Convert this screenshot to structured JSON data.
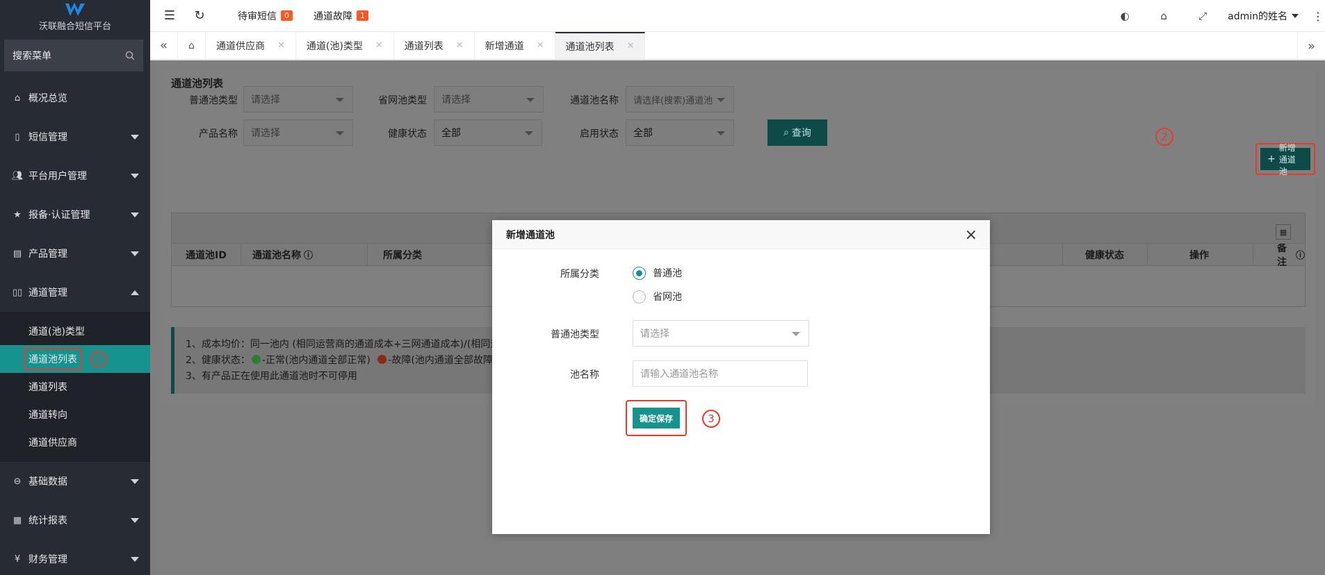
{
  "app": {
    "title": "沃联融合短信平台"
  },
  "sidebar": {
    "search_label": "搜索菜单",
    "items": [
      {
        "label": "概况总览",
        "icon": "home-icon"
      },
      {
        "label": "短信管理",
        "icon": "phone-icon"
      },
      {
        "label": "平台用户管理",
        "icon": "users-icon"
      },
      {
        "label": "报备·认证管理",
        "icon": "star-icon"
      },
      {
        "label": "产品管理",
        "icon": "product-icon"
      },
      {
        "label": "通道管理",
        "icon": "channel-icon"
      },
      {
        "label": "基础数据",
        "icon": "data-icon"
      },
      {
        "label": "统计报表",
        "icon": "report-icon"
      },
      {
        "label": "财务管理",
        "icon": "finance-icon"
      }
    ],
    "sub_items": [
      "通道(池)类型",
      "通道池列表",
      "通道列表",
      "通道转向",
      "通道供应商"
    ],
    "annotation_1": "1"
  },
  "topbar": {
    "pending_sms": "待审短信",
    "pending_sms_count": "0",
    "channel_fault": "通道故障",
    "channel_fault_count": "1",
    "user_name": "admin的姓名"
  },
  "tabs": [
    "通道供应商",
    "通道(池)类型",
    "通道列表",
    "新增通道",
    "通道池列表"
  ],
  "page": {
    "title": "通道池列表",
    "filters": {
      "normal_pool_type_label": "普通池类型",
      "normal_pool_type_value": "请选择",
      "province_pool_type_label": "省网池类型",
      "province_pool_type_value": "请选择",
      "pool_name_label": "通道池名称",
      "pool_name_value": "请选择(搜索)通道池",
      "product_name_label": "产品名称",
      "product_name_value": "请选择",
      "health_label": "健康状态",
      "health_value": "全部",
      "enabled_label": "启用状态",
      "enabled_value": "全部"
    },
    "query_button": "查询",
    "add_button": "新增通道池",
    "annotation_2": "2",
    "table_headers": [
      "通道池ID",
      "通道池名称",
      "所属分类",
      "健康状态",
      "操作",
      "备注"
    ],
    "notes": [
      "1、成本均价：同一池内 (相同运营商的通道成本+三网通道成本)/(相同运",
      "2、健康状态：",
      "-正常(池内通道全部正常)",
      "-故障(池内通道全部故障)",
      "3、有产品正在使用此通道池时不可停用"
    ]
  },
  "modal": {
    "title": "新增通道池",
    "category_label": "所属分类",
    "category_options": [
      "普通池",
      "省网池"
    ],
    "category_selected": "普通池",
    "pool_type_label": "普通池类型",
    "pool_type_placeholder": "请选择",
    "pool_name_label": "池名称",
    "pool_name_placeholder": "请输入通道池名称",
    "save_button": "确定保存",
    "annotation_3": "3"
  },
  "colors": {
    "accent": "#16938f",
    "annotation": "#e53b2a",
    "sidebar": "#272b33",
    "ok": "#2ea44f",
    "fault": "#e5431f"
  }
}
